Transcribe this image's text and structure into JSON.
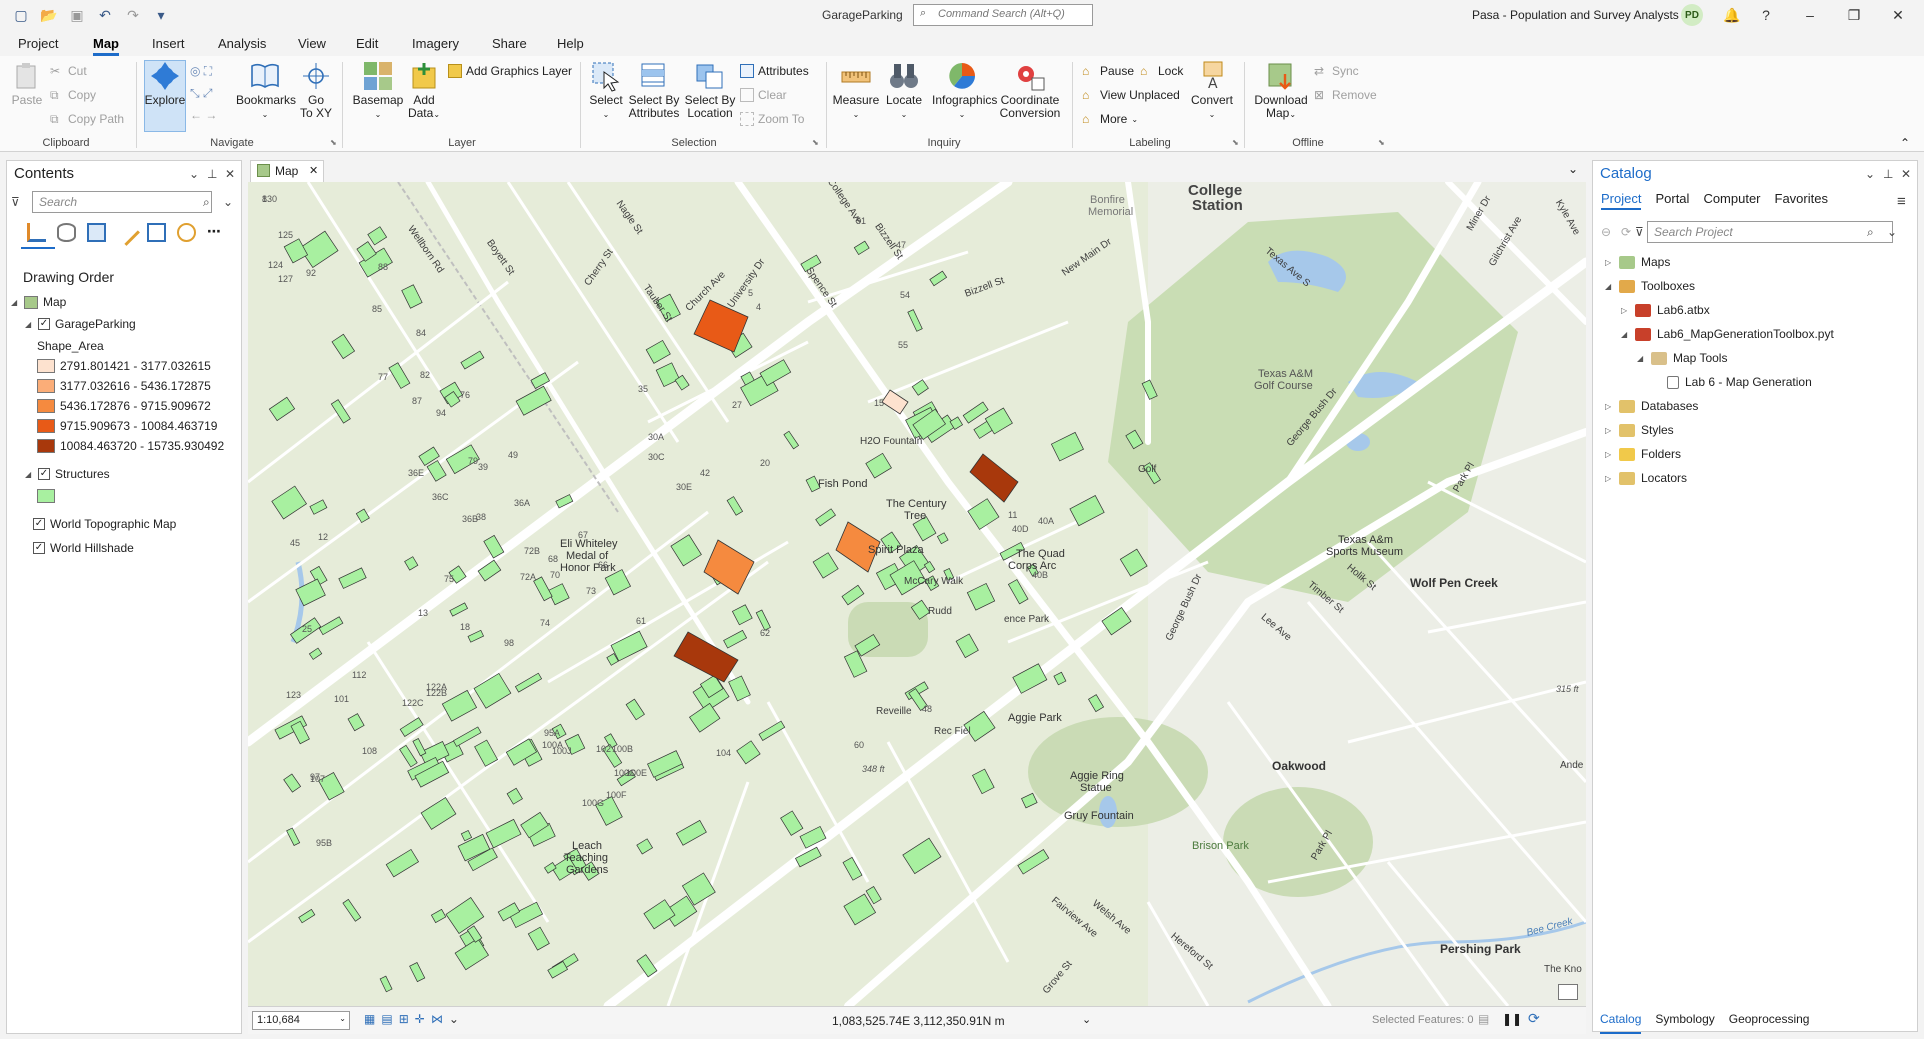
{
  "titlebar": {
    "project_name": "GarageParking",
    "command_search_placeholder": "Command Search (Alt+Q)",
    "org_name": "Pasa - Population and Survey Analysts",
    "user_initials": "PD",
    "controls": [
      "?",
      "–",
      "❐",
      "✕"
    ]
  },
  "ribbon_tabs": [
    "Project",
    "Map",
    "Insert",
    "Analysis",
    "View",
    "Edit",
    "Imagery",
    "Share",
    "Help"
  ],
  "ribbon": {
    "clipboard": {
      "label": "Clipboard",
      "paste": "Paste",
      "cut": "Cut",
      "copy": "Copy",
      "copy_path": "Copy Path"
    },
    "navigate": {
      "label": "Navigate",
      "explore": "Explore",
      "bookmarks": "Bookmarks",
      "goto_xy_1": "Go",
      "goto_xy_2": "To XY"
    },
    "layer": {
      "label": "Layer",
      "basemap": "Basemap",
      "add_data_1": "Add",
      "add_data_2": "Data",
      "add_graphics_layer": "Add Graphics Layer"
    },
    "selection": {
      "label": "Selection",
      "select": "Select",
      "select_by_attr_1": "Select By",
      "select_by_attr_2": "Attributes",
      "select_by_loc_1": "Select By",
      "select_by_loc_2": "Location",
      "attributes": "Attributes",
      "clear": "Clear",
      "zoom_to": "Zoom To"
    },
    "inquiry": {
      "label": "Inquiry",
      "measure": "Measure",
      "locate": "Locate",
      "infographics": "Infographics",
      "coord_conv_1": "Coordinate",
      "coord_conv_2": "Conversion"
    },
    "labeling": {
      "label": "Labeling",
      "pause": "Pause",
      "lock": "Lock",
      "view_unplaced": "View Unplaced",
      "more": "More",
      "convert": "Convert"
    },
    "offline": {
      "label": "Offline",
      "download_map_1": "Download",
      "download_map_2": "Map",
      "sync": "Sync",
      "remove": "Remove"
    }
  },
  "contents": {
    "title": "Contents",
    "search_placeholder": "Search",
    "drawing_order": "Drawing Order",
    "map_name": "Map",
    "layer_garage": "GarageParking",
    "field_name": "Shape_Area",
    "classes": [
      {
        "label": "2791.801421 - 3177.032615",
        "color": "#fde2cf"
      },
      {
        "label": "3177.032616 - 5436.172875",
        "color": "#fbad78"
      },
      {
        "label": "5436.172876 - 9715.909672",
        "color": "#f58a3f"
      },
      {
        "label": "9715.909673 - 10084.463719",
        "color": "#e85a17"
      },
      {
        "label": "10084.463720 - 15735.930492",
        "color": "#a8380c"
      }
    ],
    "layer_structures": "Structures",
    "structures_color": "#a8f0a0",
    "layer_topo": "World Topographic Map",
    "layer_hillshade": "World Hillshade"
  },
  "map_view": {
    "tab_label": "Map",
    "labels": {
      "college_station_1": "College",
      "college_station_2": "Station",
      "bonfire_1": "Bonfire",
      "bonfire_2": "Memorial",
      "golf_1": "Texas A&M",
      "golf_2": "Golf Course",
      "sports_1": "Texas A&m",
      "sports_2": "Sports Museum",
      "wolf_pen": "Wolf Pen Creek",
      "oakwood": "Oakwood",
      "pershing": "Pershing Park",
      "brison": "Brison Park",
      "fish_pond": "Fish Pond",
      "century_tree_1": "The Century",
      "century_tree_2": "Tree",
      "spirit_plaza": "Spirit Plaza",
      "quad_1": "The Quad",
      "quad_2": "Corps Arc",
      "aggie_park": "Aggie Park",
      "aggie_ring_1": "Aggie Ring",
      "aggie_ring_2": "Statue",
      "gruy": "Gruy Fountain",
      "leach_1": "Leach",
      "leach_2": "Teaching",
      "leach_3": "Gardens",
      "whiteley_1": "Eli Whiteley",
      "whiteley_2": "Medal of",
      "whiteley_3": "Honor Park",
      "h2o": "H2O Fountain",
      "golf": "Golf",
      "the_kno": "The Kno",
      "ande": "Ande",
      "elev_315": "315 ft",
      "elev_348": "348 ft",
      "reveille": "Reveille",
      "rudd": "Rudd",
      "mcclary": "McCary Walk",
      "rec_field": "Rec Fiel",
      "ence_park": "ence Park"
    },
    "streets": {
      "college_ave": "College Ave",
      "wellborn": "Wellborn Rd",
      "boyett": "Boyett St",
      "cherry": "Cherry St",
      "nagle": "Nagle St",
      "tauber": "Tauber St",
      "church": "Church Ave",
      "university": "University Dr",
      "spence": "Spence St",
      "bizzell": "Bizzell St",
      "new_main": "New Main Dr",
      "texas_ave": "Texas Ave S",
      "george_bush": "George Bush Dr",
      "timber": "Timber St",
      "lee_ave": "Lee Ave",
      "holik": "Holik St",
      "fairview": "Fairview Ave",
      "welsh": "Welsh Ave",
      "hereford": "Hereford St",
      "grove": "Grove St",
      "park_pl": "Park Pl",
      "gilchrist": "Gilchrist Ave",
      "miner": "Miner Dr",
      "kyle": "Kyle Ave",
      "bee_creek": "Bee Creek"
    },
    "numbers": [
      "130",
      "125",
      "124",
      "127",
      "92",
      "88",
      "85",
      "84",
      "77",
      "82",
      "76",
      "87",
      "94",
      "79",
      "36E",
      "36C",
      "36B",
      "36A",
      "45",
      "75",
      "12",
      "38",
      "49",
      "39",
      "5",
      "4",
      "72B",
      "72A",
      "70",
      "68",
      "67",
      "66",
      "74",
      "73",
      "18",
      "13",
      "25",
      "98",
      "122A",
      "122B",
      "122C",
      "123",
      "101",
      "112",
      "108",
      "107",
      "97",
      "95B",
      "95A",
      "100A",
      "100B",
      "100C",
      "100E",
      "100F",
      "100G",
      "100J",
      "102",
      "104",
      "62",
      "61",
      "60",
      "48",
      "51",
      "47",
      "54",
      "55",
      "15",
      "35",
      "30A",
      "30C",
      "30E",
      "42",
      "20",
      "27",
      "11",
      "40A",
      "40B",
      "40D",
      "8"
    ]
  },
  "statusbar": {
    "scale": "1:10,684",
    "coords": "1,083,525.74E 3,112,350.91N m",
    "selected_features": "Selected Features: 0"
  },
  "catalog": {
    "title": "Catalog",
    "tabs": [
      "Project",
      "Portal",
      "Computer",
      "Favorites"
    ],
    "search_placeholder": "Search Project",
    "tree": {
      "maps": "Maps",
      "toolboxes": "Toolboxes",
      "lab6_atbx": "Lab6.atbx",
      "lab6_pyt": "Lab6_MapGenerationToolbox.pyt",
      "map_tools": "Map Tools",
      "lab6_tool": "Lab 6 - Map Generation",
      "databases": "Databases",
      "styles": "Styles",
      "folders": "Folders",
      "locators": "Locators"
    },
    "bottom_tabs": [
      "Catalog",
      "Symbology",
      "Geoprocessing"
    ]
  }
}
